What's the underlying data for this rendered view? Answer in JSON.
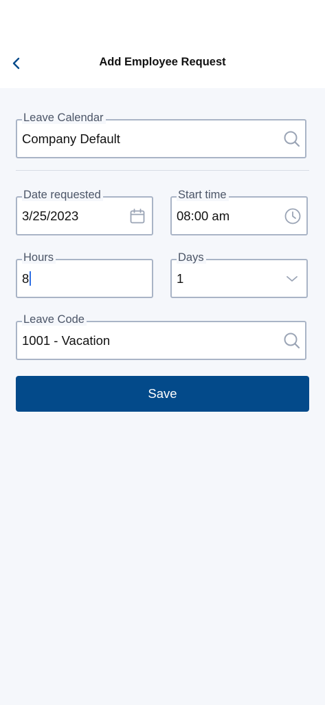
{
  "header": {
    "title": "Add Employee Request",
    "back_icon": "chevron-left-icon"
  },
  "form": {
    "leave_calendar": {
      "label": "Leave Calendar",
      "value": "Company Default",
      "icon": "search-icon"
    },
    "date_requested": {
      "label": "Date requested",
      "value": "3/25/2023",
      "icon": "calendar-icon"
    },
    "start_time": {
      "label": "Start time",
      "value": "08:00 am",
      "icon": "clock-icon"
    },
    "hours": {
      "label": "Hours",
      "value": "8"
    },
    "days": {
      "label": "Days",
      "value": "1",
      "icon": "chevron-down-icon"
    },
    "leave_code": {
      "label": "Leave Code",
      "value": "1001 - Vacation",
      "icon": "search-icon"
    }
  },
  "actions": {
    "save_label": "Save"
  },
  "colors": {
    "accent": "#034a8a",
    "field_border": "#a9b4c6",
    "background": "#f5f7fb",
    "icon": "#9aa4b5",
    "caret": "#2f6fe4"
  }
}
